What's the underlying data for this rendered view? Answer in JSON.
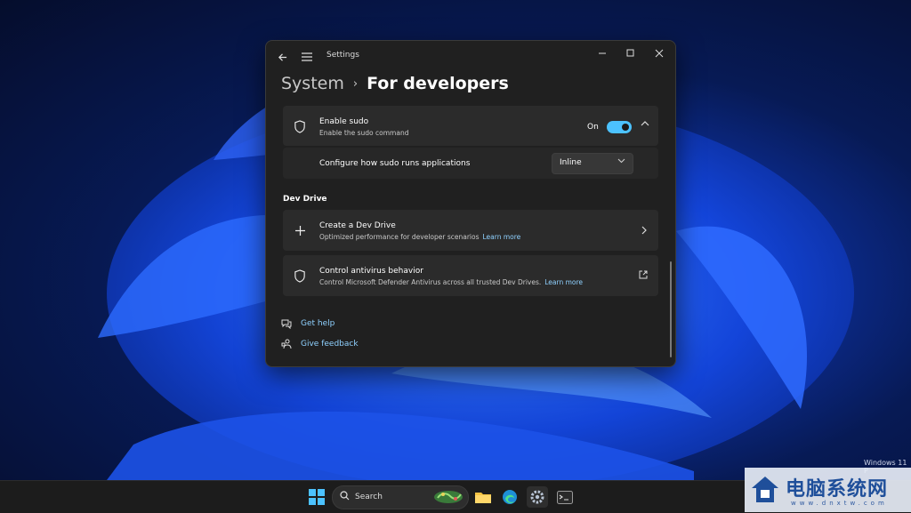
{
  "window": {
    "app_title": "Settings",
    "breadcrumb": {
      "parent": "System",
      "separator": "›",
      "current": "For developers"
    }
  },
  "sudo": {
    "title": "Enable sudo",
    "description": "Enable the sudo command",
    "toggle_state": "On",
    "config_label": "Configure how sudo runs applications",
    "mode_selected": "Inline"
  },
  "dev_drive": {
    "section_title": "Dev Drive",
    "create": {
      "title": "Create a Dev Drive",
      "description": "Optimized performance for developer scenarios",
      "link": "Learn more"
    },
    "antivirus": {
      "title": "Control antivirus behavior",
      "description": "Control Microsoft Defender Antivirus across all trusted Dev Drives.",
      "link": "Learn more"
    }
  },
  "help": {
    "get_help": "Get help",
    "give_feedback": "Give feedback"
  },
  "taskbar": {
    "search_label": "Search"
  },
  "desktop": {
    "watermark": "Windows 11 P",
    "logo_text": "电脑系统网",
    "logo_url": "www.dnxtw.com"
  },
  "colors": {
    "accent": "#4cc2ff",
    "window_bg": "#202020",
    "card_bg": "#2b2b2b"
  }
}
